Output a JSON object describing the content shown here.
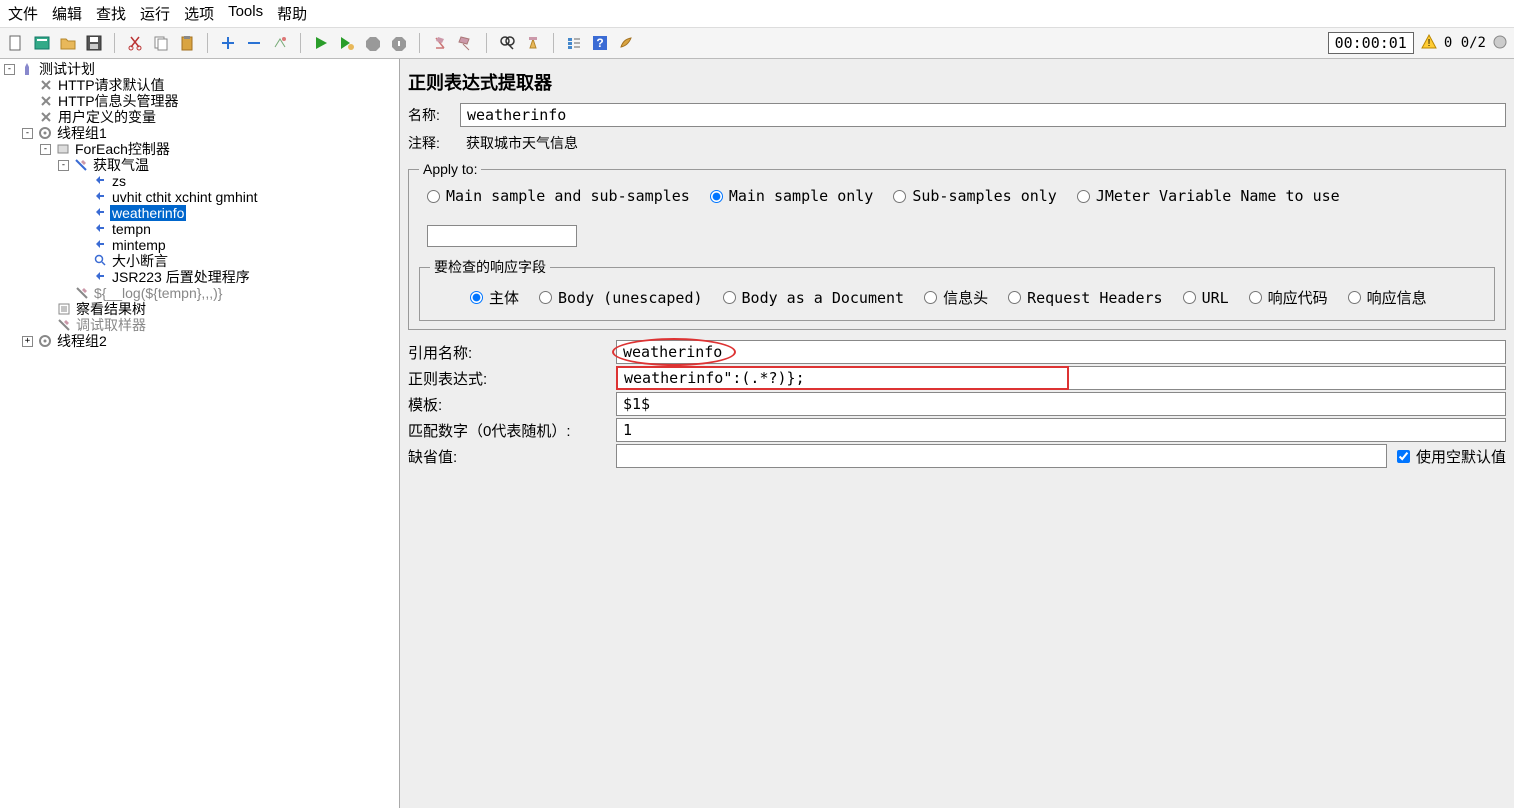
{
  "menu": [
    "文件",
    "编辑",
    "查找",
    "运行",
    "选项",
    "Tools",
    "帮助"
  ],
  "toolbarStatus": {
    "timer": "00:00:01",
    "counts": "0 0/2"
  },
  "tree": {
    "root": "测试计划",
    "n1": "HTTP请求默认值",
    "n2": "HTTP信息头管理器",
    "n3": "用户定义的变量",
    "tg1": "线程组1",
    "fe": "ForEach控制器",
    "gq": "获取气温",
    "zs": "zs",
    "uv": "uvhit cthit xchint gmhint",
    "wi": "weatherinfo",
    "tmp": "tempn",
    "min": "mintemp",
    "sz": "大小断言",
    "jsr": "JSR223 后置处理程序",
    "log": "${__log(${tempn},,,)}",
    "res": "察看结果树",
    "dbg": "调试取样器",
    "tg2": "线程组2"
  },
  "panel": {
    "title": "正则表达式提取器",
    "nameLbl": "名称:",
    "nameVal": "weatherinfo",
    "commentLbl": "注释:",
    "commentVal": "获取城市天气信息",
    "applyLegend": "Apply to:",
    "apply": {
      "a": "Main sample and sub-samples",
      "b": "Main sample only",
      "c": "Sub-samples only",
      "d": "JMeter Variable Name to use"
    },
    "fieldLegend": "要检查的响应字段",
    "field": {
      "a": "主体",
      "b": "Body (unescaped)",
      "c": "Body as a Document",
      "d": "信息头",
      "e": "Request Headers",
      "f": "URL",
      "g": "响应代码",
      "h": "响应信息"
    },
    "refNameLbl": "引用名称:",
    "refNameVal": "weatherinfo",
    "regexLbl": "正则表达式:",
    "regexVal": "weatherinfo\":(.*?)};",
    "templateLbl": "模板:",
    "templateVal": "$1$",
    "matchLbl": "匹配数字（0代表随机）:",
    "matchVal": "1",
    "defaultLbl": "缺省值:",
    "defaultVal": "",
    "useEmptyLbl": "使用空默认值"
  }
}
